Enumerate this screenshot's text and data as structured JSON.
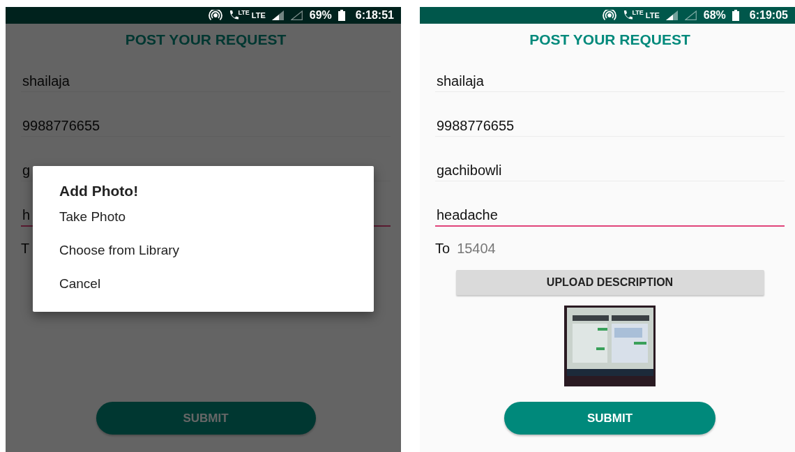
{
  "screens": [
    {
      "status_bar": {
        "call_lte": "LTE",
        "lte": "LTE",
        "battery": "69%",
        "time": "6:18:51"
      },
      "title": "POST YOUR REQUEST",
      "fields": [
        {
          "value": "shailaja",
          "focused": false
        },
        {
          "value": "9988776655",
          "focused": false
        },
        {
          "value": "g",
          "focused": false
        },
        {
          "value": "h",
          "focused": true
        }
      ],
      "to": {
        "label": "T"
      },
      "submit": "SUBMIT",
      "dialog": {
        "title": "Add Photo!",
        "options": [
          "Take Photo",
          "Choose from Library",
          "Cancel"
        ]
      }
    },
    {
      "status_bar": {
        "call_lte": "LTE",
        "lte": "LTE",
        "battery": "68%",
        "time": "6:19:05"
      },
      "title": "POST YOUR REQUEST",
      "fields": [
        {
          "value": "shailaja",
          "focused": false
        },
        {
          "value": "9988776655",
          "focused": false
        },
        {
          "value": "gachibowli",
          "focused": false
        },
        {
          "value": "headache",
          "focused": true
        }
      ],
      "to": {
        "label": "To",
        "value": "15404"
      },
      "upload_button": "UPLOAD DESCRIPTION",
      "submit": "SUBMIT"
    }
  ]
}
